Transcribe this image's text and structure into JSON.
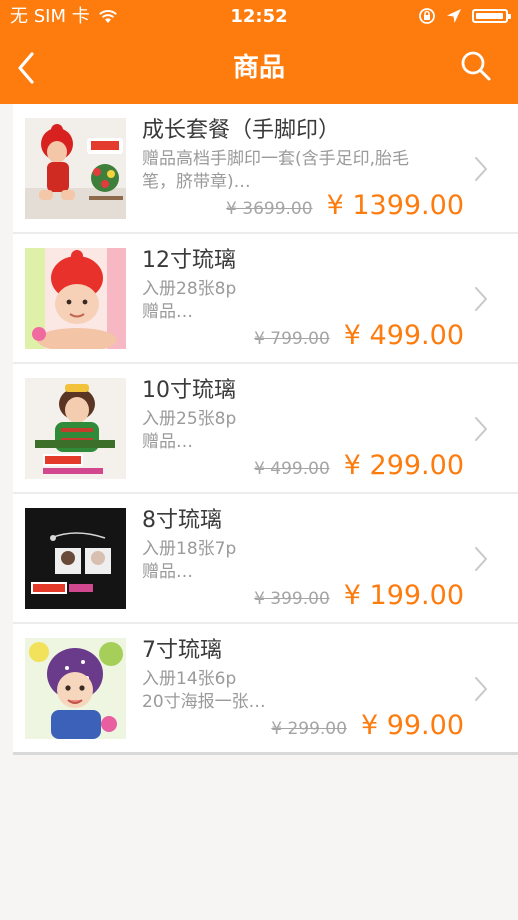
{
  "status_bar": {
    "carrier": "无 SIM 卡",
    "time": "12:52"
  },
  "nav": {
    "title": "商品",
    "back_icon": "chevron-left-icon",
    "search_icon": "search-icon"
  },
  "colors": {
    "accent": "#fe7b0d",
    "old_price": "#a5a5a5",
    "desc": "#9a9a9a"
  },
  "products": [
    {
      "title": "成长套餐（手脚印）",
      "desc": [
        "赠品高档手脚印一套(含手足印,胎毛",
        "笔，脐带章)…"
      ],
      "old_price": "¥ 3699.00",
      "price": "¥  1399.00"
    },
    {
      "title": "12寸琉璃",
      "desc": [
        "入册28张8p",
        "赠品…"
      ],
      "old_price": "¥ 799.00",
      "price": "¥  499.00"
    },
    {
      "title": "10寸琉璃",
      "desc": [
        "入册25张8p",
        "赠品…"
      ],
      "old_price": "¥ 499.00",
      "price": "¥  299.00"
    },
    {
      "title": "8寸琉璃",
      "desc": [
        "入册18张7p",
        "赠品…"
      ],
      "old_price": "¥ 399.00",
      "price": "¥  199.00"
    },
    {
      "title": "7寸琉璃",
      "desc": [
        "入册14张6p",
        "20寸海报一张…"
      ],
      "old_price": "¥ 299.00",
      "price": "¥  99.00"
    }
  ]
}
